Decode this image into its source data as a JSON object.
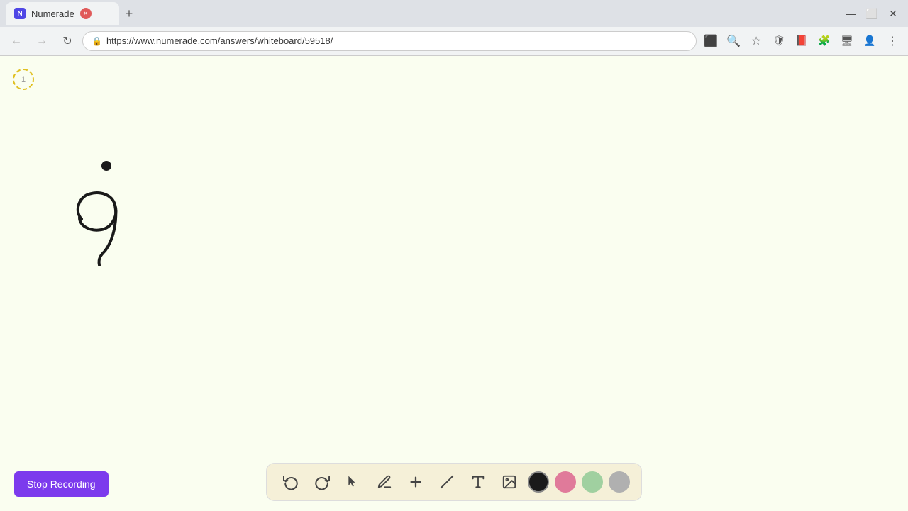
{
  "browser": {
    "tab_title": "Numerade",
    "tab_favicon": "N",
    "url": "https://www.numerade.com/answers/whiteboard/59518/",
    "new_tab_icon": "+",
    "win_minimize": "—",
    "win_maximize": "⬜",
    "win_close": "✕"
  },
  "nav": {
    "back_title": "Back",
    "forward_title": "Forward",
    "reload_title": "Reload",
    "address_text": "https://www.numerade.com/answers/whiteboard/59518/",
    "lock_icon": "🔒"
  },
  "toolbar": {
    "undo_label": "↺",
    "redo_label": "↻",
    "select_label": "▲",
    "pencil_label": "✏",
    "plus_label": "+",
    "eraser_label": "/",
    "text_label": "A",
    "image_label": "🖼",
    "color_black": "#1a1a1a",
    "color_pink": "#e07a9a",
    "color_green": "#a0d0a0",
    "color_gray": "#b0b0b0"
  },
  "stop_recording": {
    "label": "Stop Recording"
  },
  "timer": {
    "display": "1"
  },
  "whiteboard": {
    "bg_color": "#fafef0"
  }
}
